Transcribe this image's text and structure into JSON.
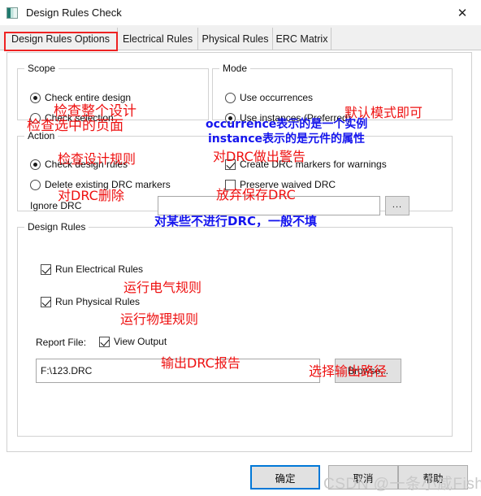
{
  "window": {
    "title": "Design Rules Check",
    "icon": "app-icon",
    "close_label": "✕"
  },
  "tabs": [
    {
      "label": "Design Rules Options",
      "active": true
    },
    {
      "label": "Electrical Rules",
      "active": false
    },
    {
      "label": "Physical Rules",
      "active": false
    },
    {
      "label": "ERC Matrix",
      "active": false
    }
  ],
  "scope": {
    "legend": "Scope",
    "options": [
      {
        "label": "Check entire design",
        "selected": true
      },
      {
        "label": "Check selection",
        "selected": false
      }
    ]
  },
  "mode": {
    "legend": "Mode",
    "options": [
      {
        "label": "Use occurrences",
        "selected": false
      },
      {
        "label": "Use instances (Preferred)",
        "selected": true
      }
    ]
  },
  "action": {
    "legend": "Action",
    "options": [
      {
        "label": "Check design rules",
        "selected": true
      },
      {
        "label": "Delete existing DRC markers",
        "selected": false
      }
    ],
    "checkboxes": [
      {
        "label": "Create DRC markers for warnings",
        "checked": true
      },
      {
        "label": "Preserve waived DRC",
        "checked": false
      }
    ],
    "ignore_drc_label": "Ignore DRC",
    "ignore_drc_value": "",
    "browse_dots_label": "..."
  },
  "design_rules": {
    "legend": "Design Rules",
    "checkboxes": [
      {
        "label": "Run Electrical Rules",
        "checked": true
      },
      {
        "label": "Run Physical Rules",
        "checked": true
      }
    ],
    "report_file_label": "Report File:",
    "view_output": {
      "label": "View Output",
      "checked": true
    },
    "report_path": "F:\\123.DRC",
    "browse_label": "Browse..."
  },
  "footer": {
    "ok_label": "确定",
    "cancel_label": "取消",
    "help_label": "帮助"
  },
  "watermark": "CSDN @一条小咸Fish",
  "annotations": [
    {
      "id": "a1",
      "text": "检查整个设计",
      "color": "red"
    },
    {
      "id": "a2",
      "text": "检查选中的页面",
      "color": "red"
    },
    {
      "id": "a3",
      "text": "默认模式即可",
      "color": "red"
    },
    {
      "id": "a4",
      "text": "occurrence表示的是一个实例",
      "color": "blue"
    },
    {
      "id": "a5",
      "text": "instance表示的是元件的属性",
      "color": "blue"
    },
    {
      "id": "a6",
      "text": "检查设计规则",
      "color": "red"
    },
    {
      "id": "a7",
      "text": "对DRC做出警告",
      "color": "red"
    },
    {
      "id": "a8",
      "text": "对DRC删除",
      "color": "red"
    },
    {
      "id": "a9",
      "text": "放弃保存DRC",
      "color": "red"
    },
    {
      "id": "a10",
      "text": "对某些不进行DRC，一般不填",
      "color": "blue"
    },
    {
      "id": "a11",
      "text": "运行电气规则",
      "color": "red"
    },
    {
      "id": "a12",
      "text": "运行物理规则",
      "color": "red"
    },
    {
      "id": "a13",
      "text": "输出DRC报告",
      "color": "red"
    },
    {
      "id": "a14",
      "text": "选择输出路径",
      "color": "red"
    }
  ],
  "colors": {
    "accent": "#0078d7",
    "annotation_red": "#ee1111",
    "annotation_blue": "#1515ee",
    "tab_highlight": "#ee2222",
    "panel_bg": "#ffffff",
    "button_bg": "#e1e1e1"
  }
}
